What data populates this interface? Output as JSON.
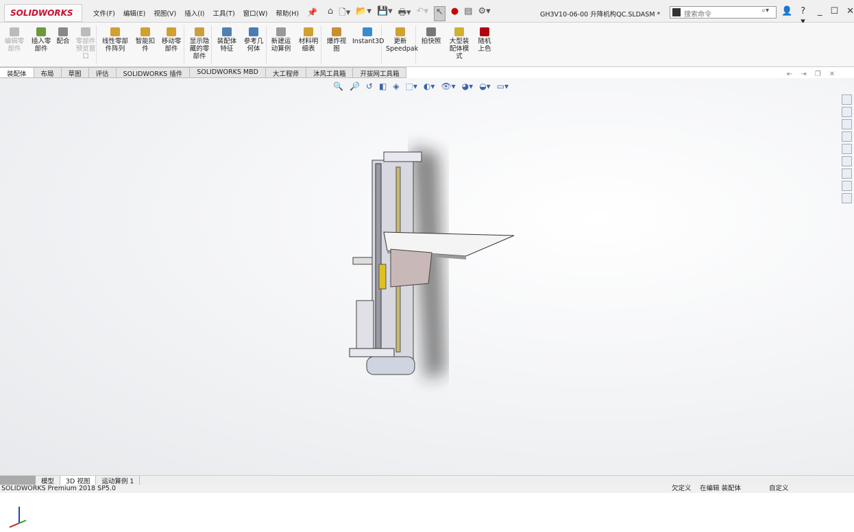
{
  "app": {
    "logo": "SOLIDWORKS",
    "document_title": "GH3V10-06-00 升降机构QC.SLDASM *"
  },
  "menu": [
    "文件(F)",
    "编辑(E)",
    "视图(V)",
    "插入(I)",
    "工具(T)",
    "窗口(W)",
    "帮助(H)"
  ],
  "search": {
    "placeholder": "搜索命令"
  },
  "ribbon": [
    {
      "label": "编辑零部件",
      "disabled": true,
      "color": "#bbbbbb"
    },
    {
      "label": "插入零部件",
      "disabled": false,
      "color": "#6a9a3a"
    },
    {
      "label": "配合",
      "disabled": false,
      "color": "#888888"
    },
    {
      "label": "零部件预览窗口",
      "disabled": true,
      "color": "#bbbbbb"
    },
    {
      "label": "线性零部件阵列",
      "disabled": false,
      "color": "#d0a030"
    },
    {
      "label": "智能扣件",
      "disabled": false,
      "color": "#d0a030"
    },
    {
      "label": "移动零部件",
      "disabled": false,
      "color": "#d0a030"
    },
    {
      "label": "显示隐藏的零部件",
      "disabled": false,
      "color": "#c8a040"
    },
    {
      "label": "装配体特征",
      "disabled": false,
      "color": "#5080b0"
    },
    {
      "label": "参考几何体",
      "disabled": false,
      "color": "#4a7ab8"
    },
    {
      "label": "新建运动算例",
      "disabled": false,
      "color": "#999999"
    },
    {
      "label": "材料明细表",
      "disabled": false,
      "color": "#d0a030"
    },
    {
      "label": "爆炸视图",
      "disabled": false,
      "color": "#c89030"
    },
    {
      "label": "Instant3D",
      "disabled": false,
      "color": "#3a8ad0"
    },
    {
      "label": "更新Speedpak",
      "disabled": false,
      "color": "#d0a030"
    },
    {
      "label": "拍快照",
      "disabled": false,
      "color": "#777777"
    },
    {
      "label": "大型装配体模式",
      "disabled": false,
      "color": "#d0b030"
    },
    {
      "label": "随机上色",
      "disabled": false,
      "color": "#b00010"
    }
  ],
  "tabs": [
    "装配体",
    "布局",
    "草图",
    "评估",
    "SOLIDWORKS 插件",
    "SOLIDWORKS MBD",
    "大工程师",
    "沐风工具箱",
    "开拔网工具箱"
  ],
  "bottom_tabs": [
    "模型",
    "3D 视图",
    "运动算例 1"
  ],
  "status": {
    "product": "SOLIDWORKS Premium 2018 SP5.0",
    "definition": "欠定义",
    "editing": "在编辑 装配体",
    "custom": "自定义"
  }
}
